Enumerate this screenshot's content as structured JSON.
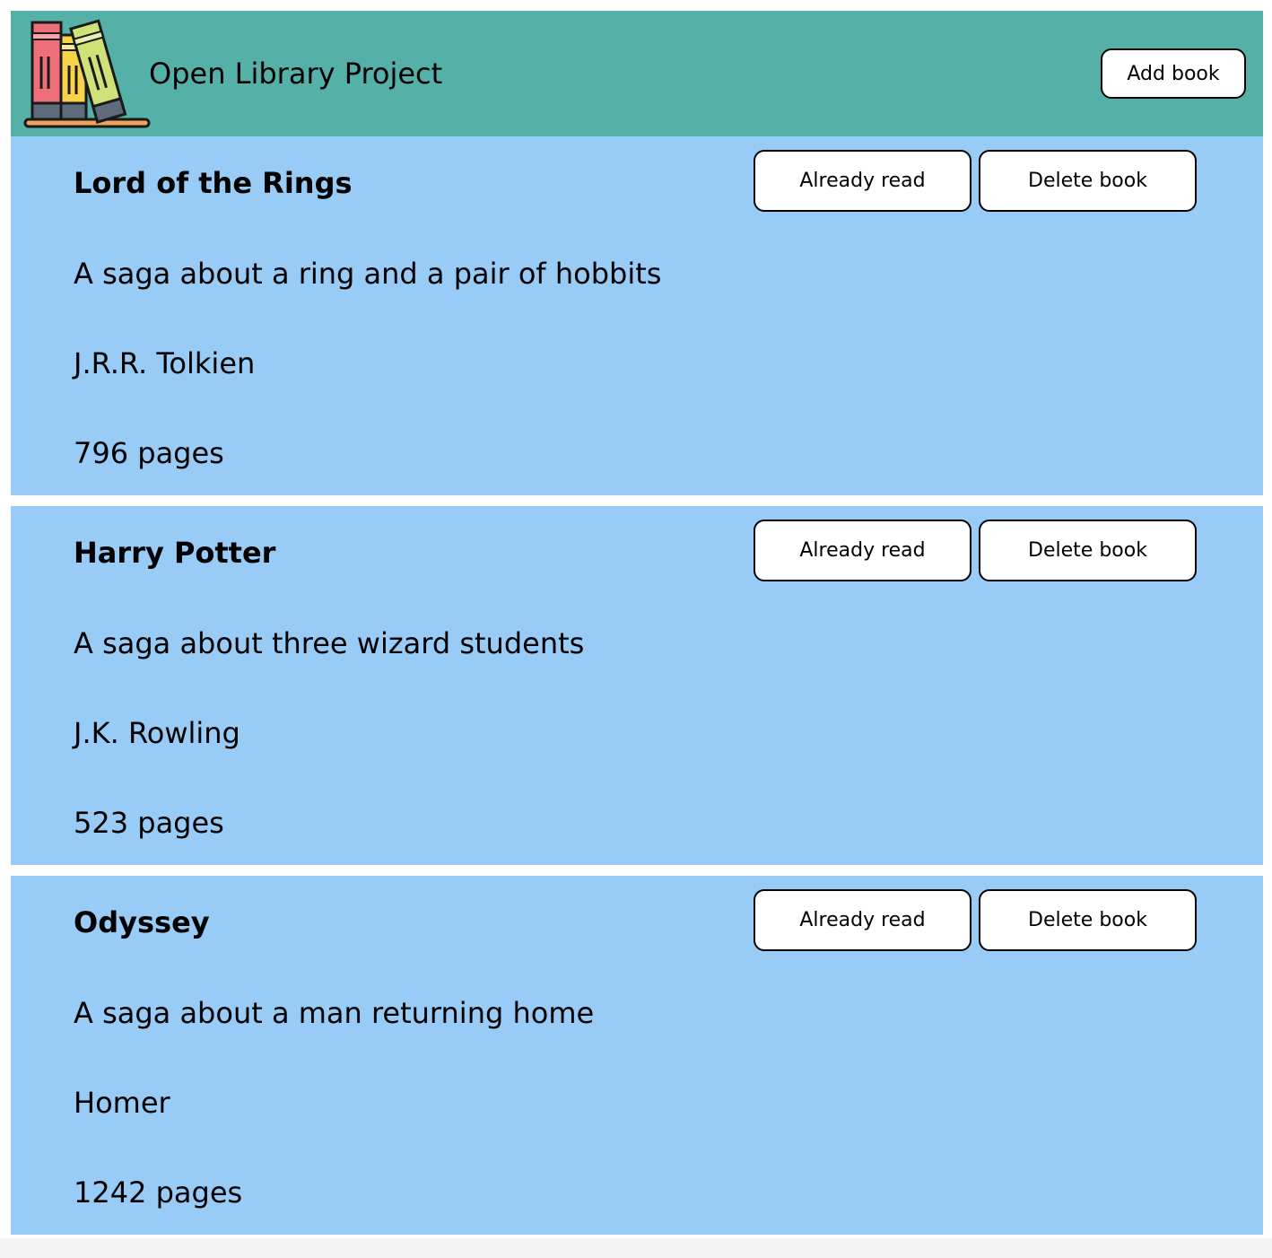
{
  "header": {
    "title": "Open Library Project",
    "add_button_label": "Add book",
    "logo_icon": "books-on-shelf-icon"
  },
  "colors": {
    "header_bg": "#55b0a8",
    "card_bg": "#98cbf5",
    "button_bg": "#ffffff"
  },
  "books": [
    {
      "title": "Lord of the Rings",
      "description": "A saga about a ring and a pair of hobbits",
      "author": "J.R.R. Tolkien",
      "pages": "796 pages",
      "read_label": "Already read",
      "delete_label": "Delete book"
    },
    {
      "title": "Harry Potter",
      "description": "A saga about three wizard students",
      "author": "J.K. Rowling",
      "pages": "523 pages",
      "read_label": "Already read",
      "delete_label": "Delete book"
    },
    {
      "title": "Odyssey",
      "description": "A saga about a man returning home",
      "author": "Homer",
      "pages": "1242 pages",
      "read_label": "Already read",
      "delete_label": "Delete book"
    }
  ]
}
